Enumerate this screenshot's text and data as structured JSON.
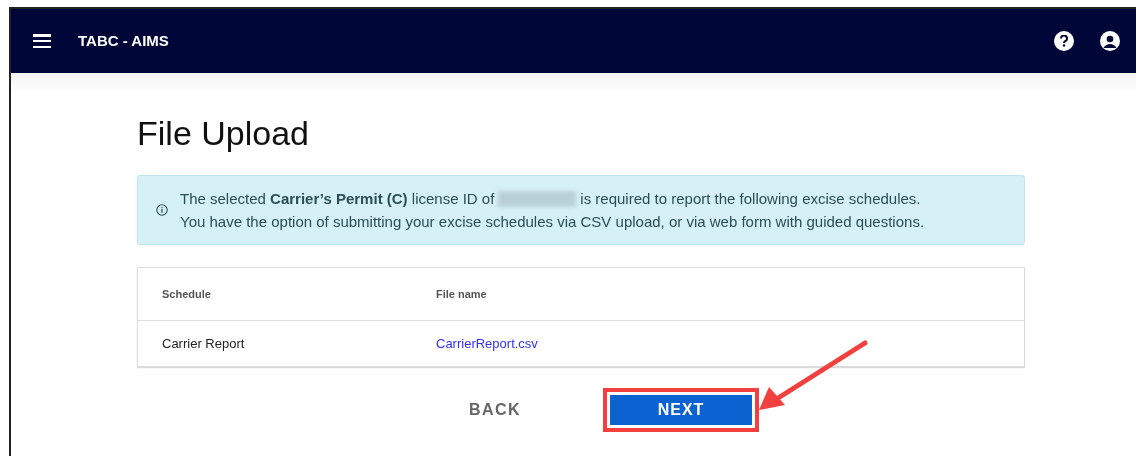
{
  "app_bar": {
    "title": "TABC - AIMS"
  },
  "page": {
    "title": "File Upload"
  },
  "notice": {
    "line_1_before": "The selected **Carrier’s Permit (C)** license ID of",
    "line_1_after": "is required to report the following excise schedules.",
    "line_2": "You have the option of submitting your excise schedules via CSV upload, or via web form with guided questions."
  },
  "table": {
    "columns": [
      "Schedule",
      "File name"
    ],
    "rows": [
      {
        "schedule": "Carrier Report",
        "file_name": "CarrierReport.csv"
      }
    ]
  },
  "buttons": [
    {
      "kind": "text",
      "label": "BACK",
      "highlighted": false
    },
    {
      "kind": "primary",
      "label": "NEXT",
      "highlighted": true
    }
  ]
}
